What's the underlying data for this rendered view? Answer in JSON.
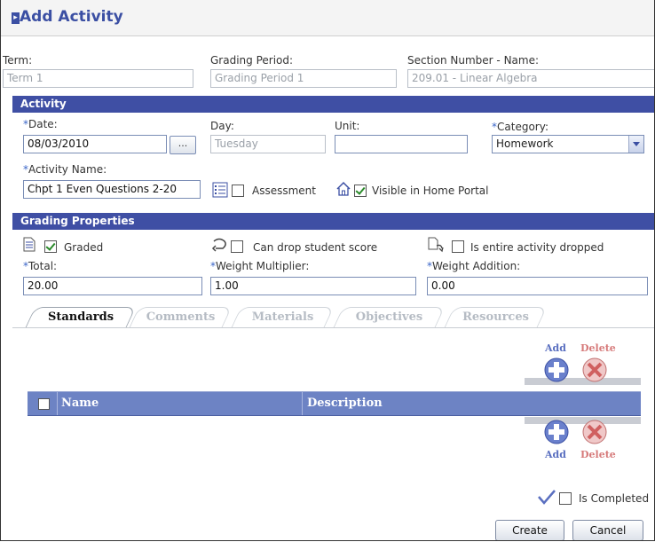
{
  "window": {
    "title": "Add Activity"
  },
  "header": {
    "term_label": "Term:",
    "term_value": "Term 1",
    "period_label": "Grading Period:",
    "period_value": "Grading Period 1",
    "section_label": "Section Number - Name:",
    "section_value": "209.01 - Linear Algebra"
  },
  "activity": {
    "band": "Activity",
    "date_req": "*",
    "date_label": "Date:",
    "date_value": "08/03/2010",
    "date_btn": "...",
    "day_label": "Day:",
    "day_value": "Tuesday",
    "unit_label": "Unit:",
    "unit_value": "",
    "category_req": "*",
    "category_label": "Category:",
    "category_value": "Homework",
    "name_req": "*",
    "name_label": "Activity Name:",
    "name_value": "Chpt 1 Even Questions 2-20",
    "assessment_label": "Assessment",
    "assessment_checked": false,
    "visible_label": "Visible in Home Portal",
    "visible_checked": true
  },
  "grading": {
    "band": "Grading Properties",
    "graded_label": "Graded",
    "graded_checked": true,
    "drop_label": "Can drop student score",
    "drop_checked": false,
    "entire_label": "Is entire activity dropped",
    "entire_checked": false,
    "total_req": "*",
    "total_label": "Total:",
    "total_value": "20.00",
    "wm_req": "*",
    "wm_label": "Weight Multiplier:",
    "wm_value": "1.00",
    "wa_req": "*",
    "wa_label": "Weight Addition:",
    "wa_value": "0.00"
  },
  "tabs": [
    "Standards",
    "Comments",
    "Materials",
    "Objectives",
    "Resources"
  ],
  "standards": {
    "add_label": "Add",
    "delete_label": "Delete",
    "columns": [
      "Name",
      "Description"
    ]
  },
  "footer": {
    "completed_label": "Is Completed",
    "completed_checked": false,
    "create_label": "Create",
    "cancel_label": "Cancel"
  },
  "colors": {
    "accent": "#3f4fa4",
    "table_header": "#6d83c4",
    "delete": "#d67a7a",
    "add": "#5a6fc0"
  }
}
